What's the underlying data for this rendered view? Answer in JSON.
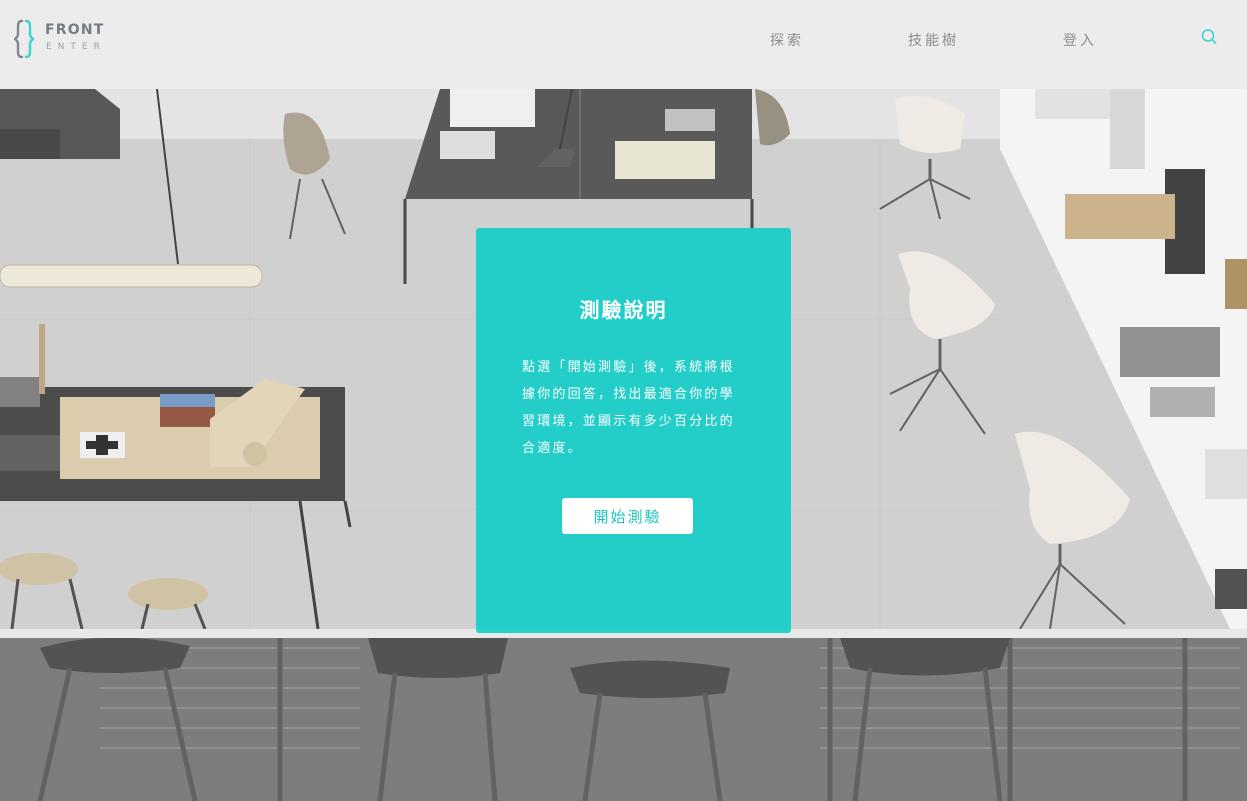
{
  "logo": {
    "line1": "FRONT",
    "line2": "ENTER"
  },
  "nav": {
    "items": [
      {
        "label": "探索"
      },
      {
        "label": "技能樹"
      },
      {
        "label": "登入"
      }
    ],
    "search_icon": "search-icon"
  },
  "card": {
    "title": "測驗說明",
    "description_lines": [
      "點選「開始測驗」後，系統將根",
      "據你的回答，找出最適合你的學",
      "習環境，並顯示有多少百分比的",
      "合適度。"
    ],
    "start_button_label": "開始測驗"
  },
  "colors": {
    "accent": "#16cdc8",
    "header_bg": "#ececec",
    "nav_text": "#8d8d8d",
    "logo_bracket_gray": "#7e878e",
    "logo_bracket_cyan": "#3fd3d0"
  }
}
